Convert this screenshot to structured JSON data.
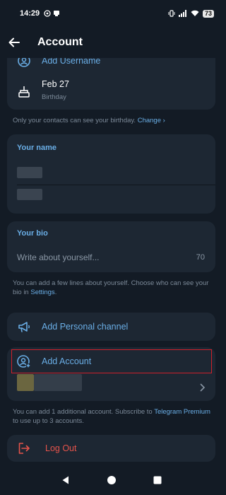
{
  "status": {
    "time": "14:29",
    "battery": "73"
  },
  "header": {
    "title": "Account"
  },
  "top_card": {
    "username_label": "Add Username",
    "birthday_value": "Feb 27",
    "birthday_caption": "Birthday"
  },
  "birthday_hint": {
    "text": "Only your contacts can see your birthday.",
    "link": "Change ›"
  },
  "name_section": {
    "title": "Your name"
  },
  "bio_section": {
    "title": "Your bio",
    "placeholder": "Write about yourself...",
    "counter": "70"
  },
  "bio_hint": {
    "text": "You can add a few lines about yourself. Choose who can see your bio in ",
    "link": "Settings",
    "end": "."
  },
  "personal_channel": {
    "label": "Add Personal channel"
  },
  "accounts": {
    "add_label": "Add Account"
  },
  "accounts_hint": {
    "text": "You can add 1 additional account. Subscribe to ",
    "link": "Telegram Premium",
    "end": " to use up to 3 accounts."
  },
  "logout": {
    "label": "Log Out"
  },
  "colors": {
    "accent": "#6aaee6",
    "danger": "#e5534b",
    "card": "#1d2733",
    "background": "#131b25",
    "highlight": "#d0202a"
  }
}
